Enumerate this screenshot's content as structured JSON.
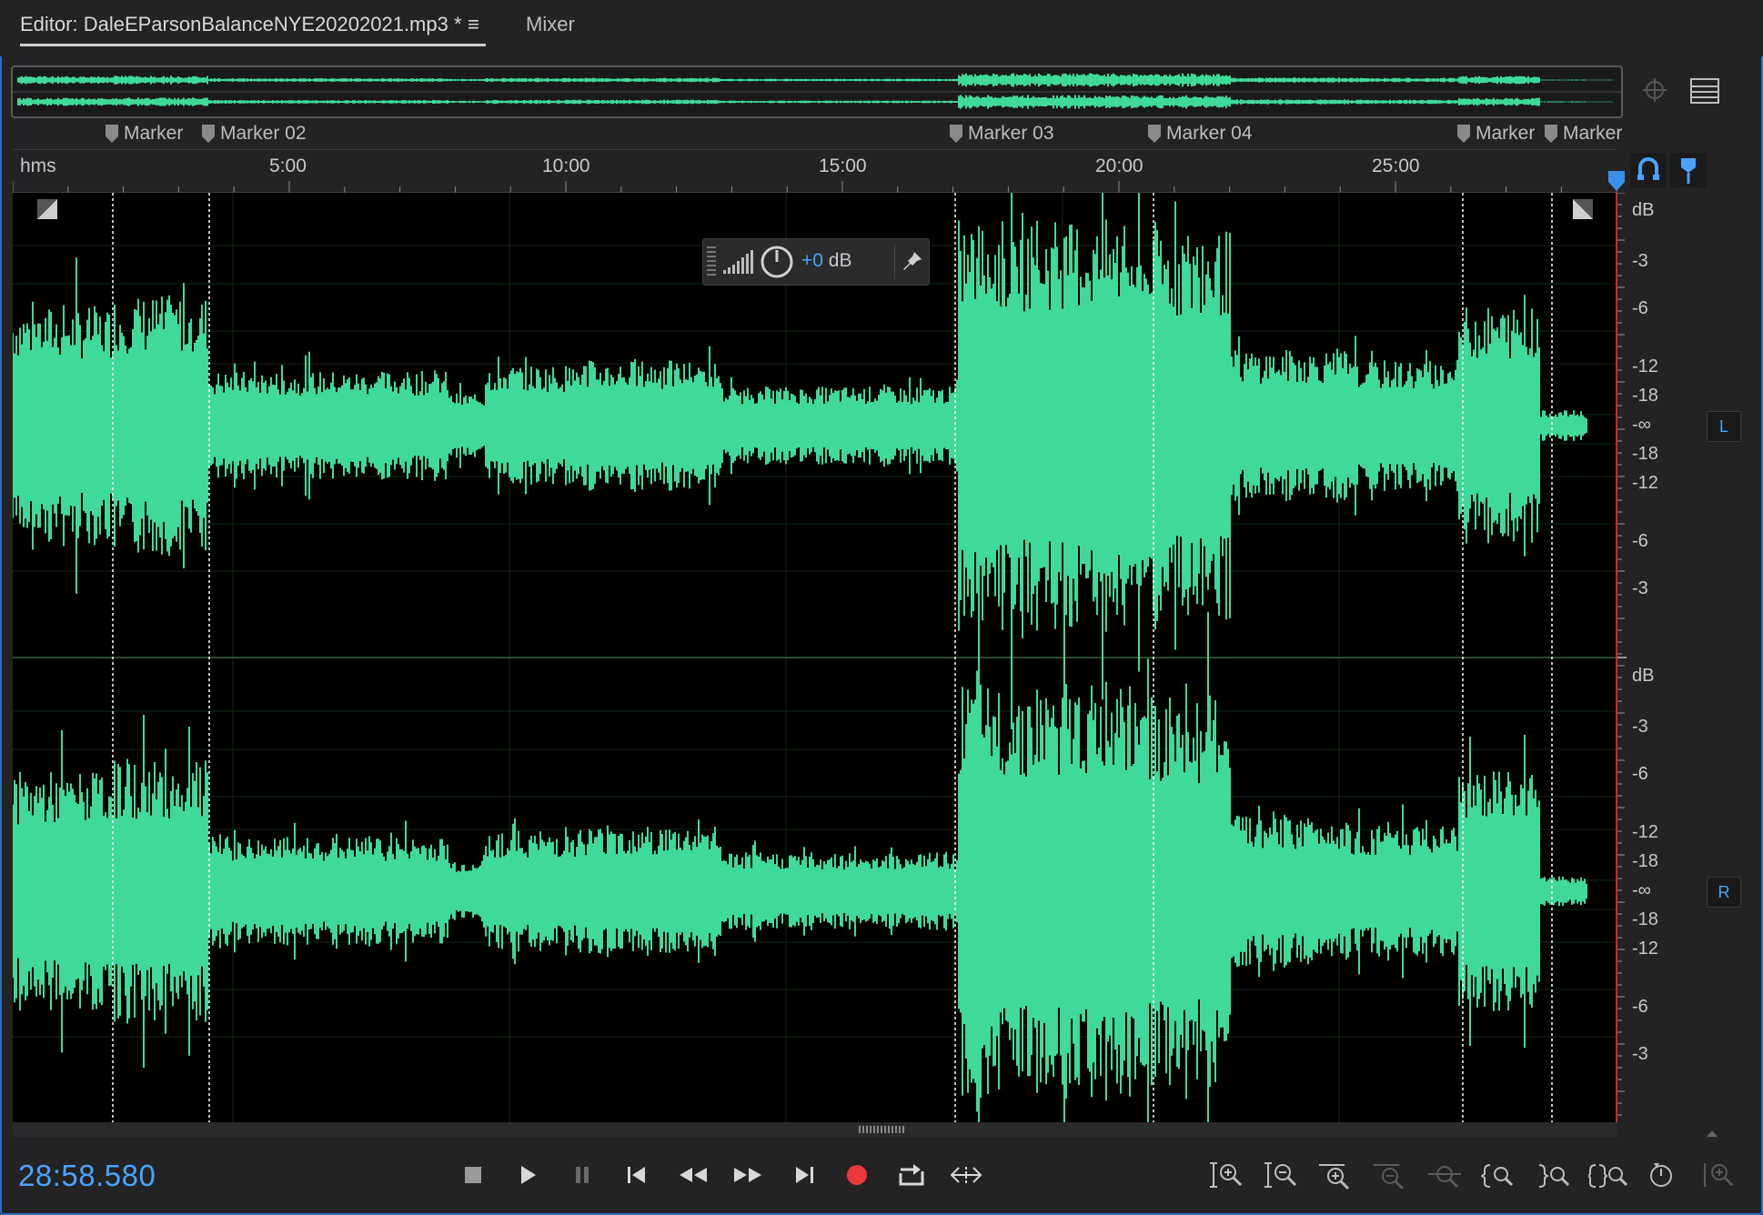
{
  "tabs": {
    "editor_label": "Editor: DaleEParsonBalanceNYE20202021.mp3 *",
    "menu_glyph": "≡",
    "mixer_label": "Mixer"
  },
  "markers": [
    "Marker",
    "Marker 02",
    "Marker 03",
    "Marker 04",
    "Marker",
    "Marker"
  ],
  "ruler": {
    "unit_label": "hms",
    "labels": [
      "5:00",
      "10:00",
      "15:00",
      "20:00",
      "25:00"
    ]
  },
  "hud": {
    "db_value": "+0",
    "db_unit": " dB"
  },
  "scale": {
    "top_channel": [
      "dB",
      "-3",
      "-6",
      "-12",
      "-18",
      "-∞",
      "-18",
      "-12",
      "-6",
      "-3"
    ],
    "bottom_channel": [
      "dB",
      "-3",
      "-6",
      "-12",
      "-18",
      "-∞",
      "-18",
      "-12",
      "-6",
      "-3"
    ],
    "left_badge": "L",
    "right_badge": "R"
  },
  "transport": {
    "timecode": "28:58.580"
  },
  "colors": {
    "waveform": "#3fd99a",
    "accent": "#4aa3ff",
    "record": "#e8383d",
    "background": "#000000"
  },
  "icons": [
    "stop-icon",
    "play-icon",
    "pause-icon",
    "skip-to-start-icon",
    "rewind-icon",
    "fast-forward-icon",
    "skip-to-end-icon",
    "record-icon",
    "loop-icon",
    "skip-selection-icon",
    "zoom-in-amplitude-icon",
    "zoom-out-amplitude-icon",
    "zoom-in-time-icon",
    "zoom-out-time-icon",
    "zoom-out-full-icon",
    "zoom-in-start-icon",
    "zoom-in-end-icon",
    "zoom-selection-icon",
    "zoom-reset-icon",
    "zoom-to-fit-icon"
  ]
}
